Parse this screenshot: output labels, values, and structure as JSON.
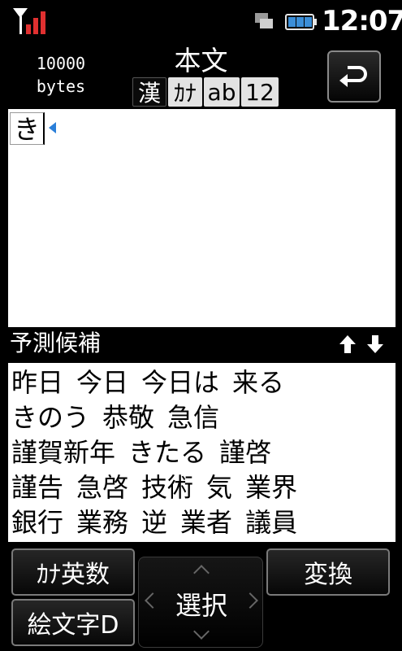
{
  "status_bar": {
    "time": "12:07",
    "signal_icon": "signal-antenna-icon",
    "network_icon": "data-transfer-icon",
    "battery_icon": "battery-icon"
  },
  "header": {
    "bytes_value": "10000",
    "bytes_unit": "bytes",
    "title": "本文",
    "modes": [
      "漢",
      "ｶﾅ",
      "ab",
      "12"
    ],
    "active_mode": "漢",
    "back_icon": "return-arrow-icon"
  },
  "editor": {
    "typed_text": "き"
  },
  "prediction": {
    "label": "予測候補",
    "scroll_icons": [
      "arrow-up-icon",
      "arrow-down-icon"
    ],
    "rows": [
      [
        "昨日",
        "今日",
        "今日は",
        "来る"
      ],
      [
        "きのう",
        "恭敬",
        "急信"
      ],
      [
        "謹賀新年",
        "きたる",
        "謹啓"
      ],
      [
        "謹告",
        "急啓",
        "技術",
        "気",
        "業界"
      ],
      [
        "銀行",
        "業務",
        "逆",
        "業者",
        "議員"
      ]
    ]
  },
  "buttons": {
    "kana_alnum": "ｶﾅ英数",
    "emoji": "絵文字D",
    "select": "選択",
    "convert": "変換"
  },
  "colors": {
    "background": "#000000",
    "text_area": "#ffffff",
    "signal_red": "#e03030",
    "cursor_blue": "#2a7fd9"
  }
}
